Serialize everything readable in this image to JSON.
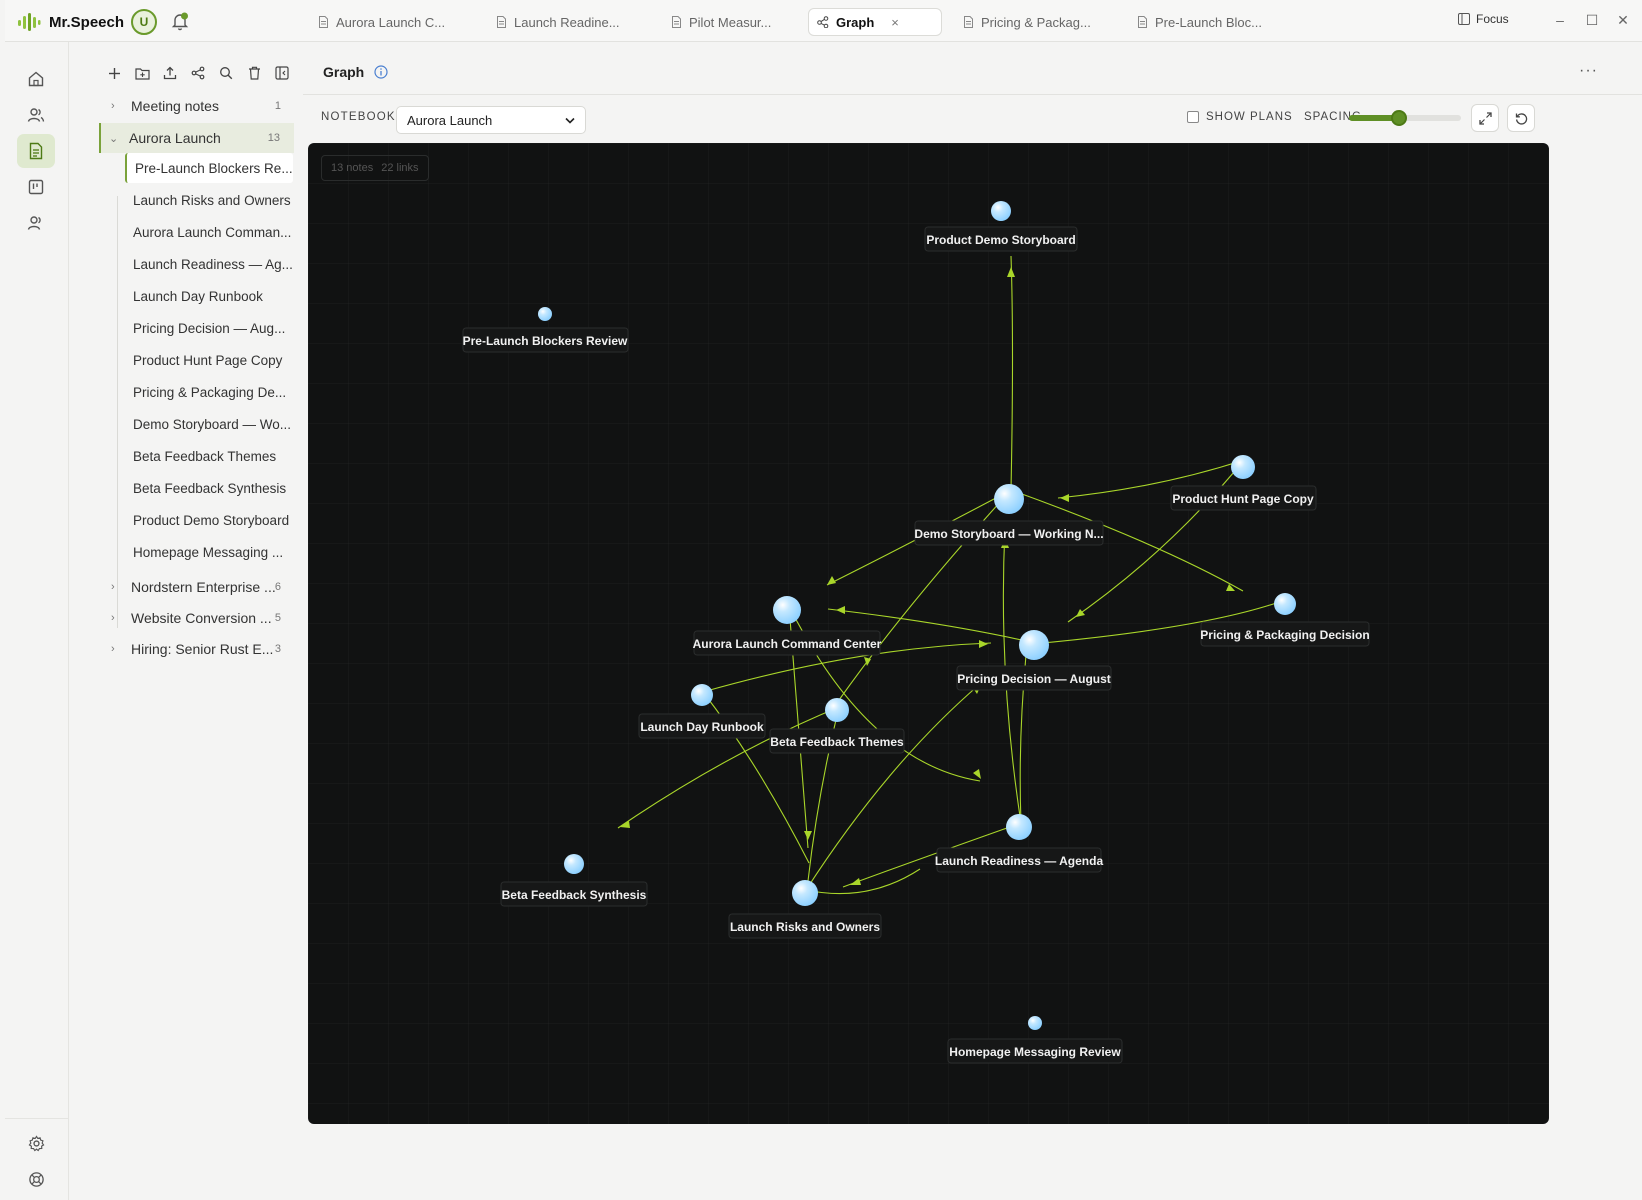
{
  "app": {
    "name": "Mr.Speech",
    "user_initial": "U",
    "accent": "#6a9a2b"
  },
  "tabs": [
    {
      "label": "Aurora Launch C...",
      "icon": "document-icon"
    },
    {
      "label": "Launch Readine...",
      "icon": "document-icon"
    },
    {
      "label": "Pilot Measur...",
      "icon": "document-icon"
    },
    {
      "label": "Graph",
      "icon": "graph-icon",
      "active": true,
      "close": "×"
    },
    {
      "label": "Pricing & Packag...",
      "icon": "document-icon"
    },
    {
      "label": "Pre-Launch Bloc...",
      "icon": "document-icon"
    }
  ],
  "titlebar": {
    "focus_label": "Focus",
    "minimize": "–",
    "maximize": "☐",
    "close": "✕"
  },
  "sidebar": {
    "notebooks": [
      {
        "label": "Meeting notes",
        "count": "1",
        "expanded": false
      },
      {
        "label": "Aurora Launch",
        "count": "13",
        "expanded": true
      },
      {
        "label": "Nordstern Enterprise ...",
        "count": "6",
        "expanded": false
      },
      {
        "label": "Website Conversion ...",
        "count": "5",
        "expanded": false
      },
      {
        "label": "Hiring: Senior Rust E...",
        "count": "3",
        "expanded": false
      }
    ],
    "notes": [
      "Pre-Launch Blockers Re...",
      "Launch Risks and Owners",
      "Aurora Launch Comman...",
      "Launch Readiness — Ag...",
      "Launch Day Runbook",
      "Pricing Decision — Aug...",
      "Product Hunt Page Copy",
      "Pricing & Packaging De...",
      "Demo Storyboard — Wo...",
      "Beta Feedback Themes",
      "Beta Feedback Synthesis",
      "Product Demo Storyboard",
      "Homepage Messaging ..."
    ]
  },
  "main": {
    "title": "Graph",
    "more": "···",
    "notebook_label": "NOTEBOOK",
    "notebook_value": "Aurora Launch",
    "show_plans_label": "SHOW PLANS",
    "spacing_label": "SPACING",
    "spacing_value": 0.45
  },
  "graph": {
    "notes_count": "13 notes",
    "links_count": "22 links",
    "node_color": "#a8dcff",
    "edge_color": "#a9d62a"
  }
}
